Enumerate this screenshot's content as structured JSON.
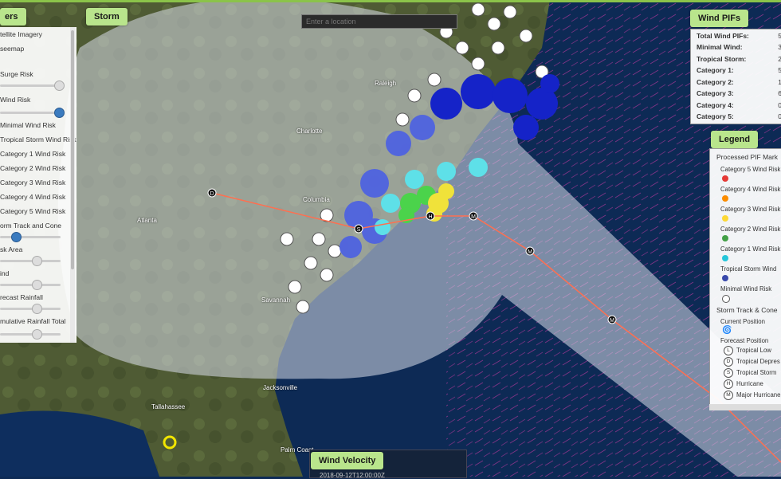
{
  "search": {
    "placeholder": "Enter a location"
  },
  "tabs": {
    "layers": "ers",
    "storm": "Storm",
    "wind_pifs": "Wind PIFs",
    "legend": "Legend",
    "wind_velocity": "Wind Velocity"
  },
  "layers": {
    "items": [
      "tellite Imagery",
      "seemap",
      "Surge Risk",
      "Wind Risk",
      "Minimal Wind Risk",
      "Tropical Storm Wind Risk",
      "Category 1 Wind Risk",
      "Category 2 Wind Risk",
      "Category 3 Wind Risk",
      "Category 4 Wind Risk",
      "Category 5 Wind Risk",
      "orm Track and Cone",
      "sk Area",
      "ind",
      "recast Rainfall",
      "mulative Rainfall Total"
    ]
  },
  "wind_pifs": {
    "rows": [
      {
        "label": "Total Wind PIFs:",
        "value": "5"
      },
      {
        "label": "Minimal Wind:",
        "value": "3"
      },
      {
        "label": "Tropical Storm:",
        "value": "2"
      },
      {
        "label": "Category 1:",
        "value": "5"
      },
      {
        "label": "Category 2:",
        "value": "1"
      },
      {
        "label": "Category 3:",
        "value": "6"
      },
      {
        "label": "Category 4:",
        "value": "0"
      },
      {
        "label": "Category 5:",
        "value": "0"
      }
    ]
  },
  "legend": {
    "section1": "Processed PIF Mark",
    "items": [
      {
        "label": "Category 5 Wind Risk",
        "color": "#e53935"
      },
      {
        "label": "Category 4 Wind Risk",
        "color": "#fb8c00"
      },
      {
        "label": "Category 3 Wind Risk",
        "color": "#fdd835"
      },
      {
        "label": "Category 2 Wind Risk",
        "color": "#43a047"
      },
      {
        "label": "Category 1 Wind Risk",
        "color": "#26c6da"
      },
      {
        "label": "Tropical Storm Wind",
        "color": "#3949ab"
      },
      {
        "label": "Minimal Wind Risk",
        "color": "#ffffff"
      }
    ],
    "section2": "Storm Track & Cone",
    "current_position": "Current Position",
    "forecast_position": "Forecast Position",
    "forecast_items": [
      {
        "letter": "L",
        "label": "Tropical Low"
      },
      {
        "letter": "D",
        "label": "Tropical Depres"
      },
      {
        "letter": "S",
        "label": "Tropical Storm"
      },
      {
        "letter": "H",
        "label": "Hurricane"
      },
      {
        "letter": "M",
        "label": "Major Hurricane"
      }
    ]
  },
  "wind_velocity": {
    "timestamp": "2018-09-12T12:00:00Z"
  },
  "map": {
    "places": [
      "Columbia",
      "Atlanta",
      "Raleigh",
      "Charlotte",
      "Savannah",
      "Jacksonville",
      "Tallahassee",
      "Palm Coast"
    ],
    "track_markers": [
      "D",
      "S",
      "H",
      "M",
      "M",
      "M"
    ]
  },
  "colors": {
    "tab_green": "#b9e58c",
    "ocean": "#0d2a55",
    "cone": "#c8d2ea"
  }
}
